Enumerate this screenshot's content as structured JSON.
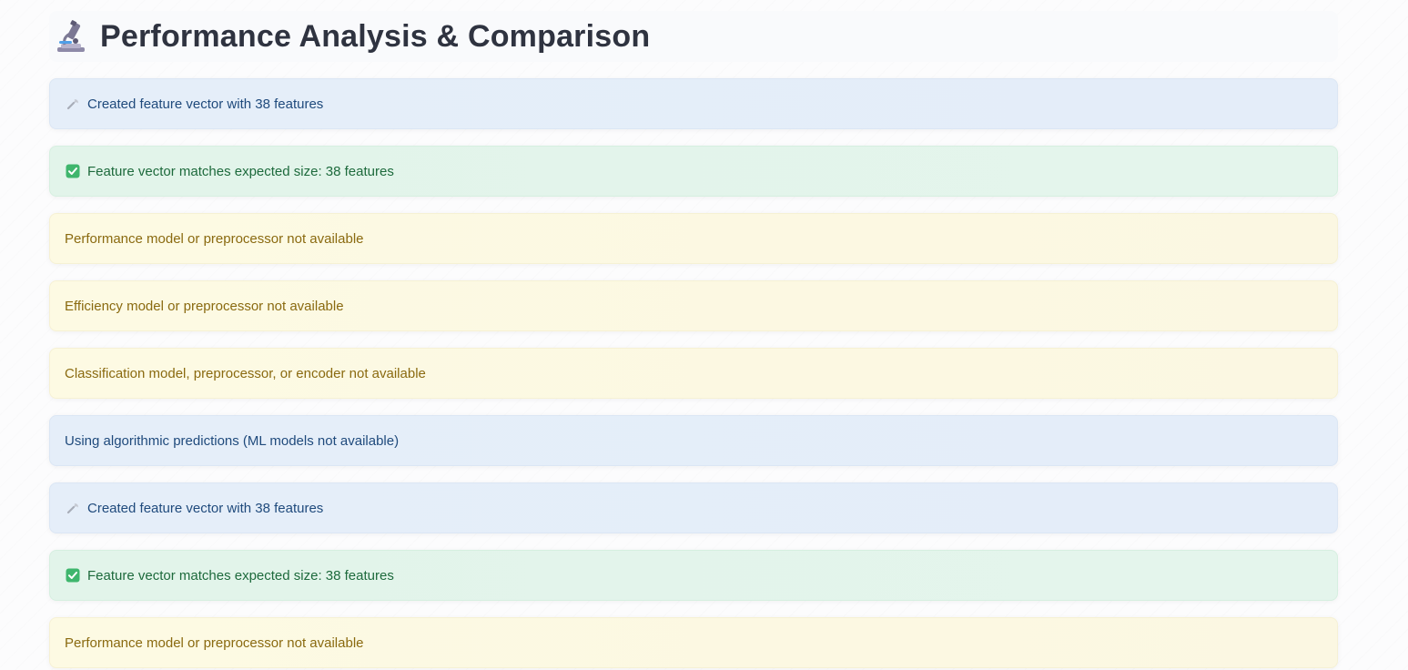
{
  "header": {
    "icon": "microscope-icon",
    "title": "Performance Analysis & Comparison"
  },
  "alerts": [
    {
      "type": "info",
      "icon": "wrench-icon",
      "text": "Created feature vector with 38 features"
    },
    {
      "type": "success",
      "icon": "check-box-icon",
      "text": "Feature vector matches expected size: 38 features"
    },
    {
      "type": "warning",
      "icon": "",
      "text": "Performance model or preprocessor not available"
    },
    {
      "type": "warning",
      "icon": "",
      "text": "Efficiency model or preprocessor not available"
    },
    {
      "type": "warning",
      "icon": "",
      "text": "Classification model, preprocessor, or encoder not available"
    },
    {
      "type": "info",
      "icon": "",
      "text": "Using algorithmic predictions (ML models not available)"
    },
    {
      "type": "info",
      "icon": "wrench-icon",
      "text": "Created feature vector with 38 features"
    },
    {
      "type": "success",
      "icon": "check-box-icon",
      "text": "Feature vector matches expected size: 38 features"
    },
    {
      "type": "warning",
      "icon": "",
      "text": "Performance model or preprocessor not available"
    }
  ],
  "colors": {
    "info_bg": "#e5eef9",
    "info_text": "#1f4a7c",
    "success_bg": "#e2f4ea",
    "success_text": "#1d6a3c",
    "warning_bg": "#fdfae3",
    "warning_text": "#8a6a10",
    "title_text": "#2f3340"
  }
}
